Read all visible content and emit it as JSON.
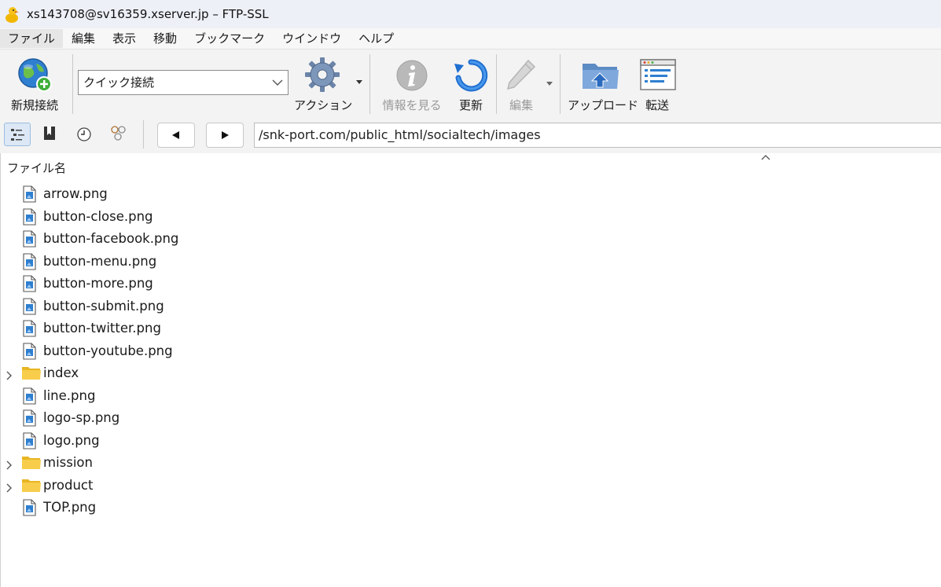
{
  "window": {
    "title": "xs143708@sv16359.xserver.jp – FTP-SSL"
  },
  "menu": {
    "items": [
      "ファイル",
      "編集",
      "表示",
      "移動",
      "ブックマーク",
      "ウインドウ",
      "ヘルプ"
    ]
  },
  "toolbar": {
    "new_connection": "新規接続",
    "quick_connect": "クイック接続",
    "action": "アクション",
    "info": "情報を見る",
    "refresh": "更新",
    "edit": "編集",
    "upload": "アップロード",
    "transfer": "転送"
  },
  "path": {
    "value": "/snk-port.com/public_html/socialtech/images"
  },
  "file_list": {
    "column_header": "ファイル名",
    "items": [
      {
        "name": "arrow.png",
        "type": "file"
      },
      {
        "name": "button-close.png",
        "type": "file"
      },
      {
        "name": "button-facebook.png",
        "type": "file"
      },
      {
        "name": "button-menu.png",
        "type": "file"
      },
      {
        "name": "button-more.png",
        "type": "file"
      },
      {
        "name": "button-submit.png",
        "type": "file"
      },
      {
        "name": "button-twitter.png",
        "type": "file"
      },
      {
        "name": "button-youtube.png",
        "type": "file"
      },
      {
        "name": "index",
        "type": "folder"
      },
      {
        "name": "line.png",
        "type": "file"
      },
      {
        "name": "logo-sp.png",
        "type": "file"
      },
      {
        "name": "logo.png",
        "type": "file"
      },
      {
        "name": "mission",
        "type": "folder"
      },
      {
        "name": "product",
        "type": "folder"
      },
      {
        "name": "TOP.png",
        "type": "file"
      }
    ]
  }
}
